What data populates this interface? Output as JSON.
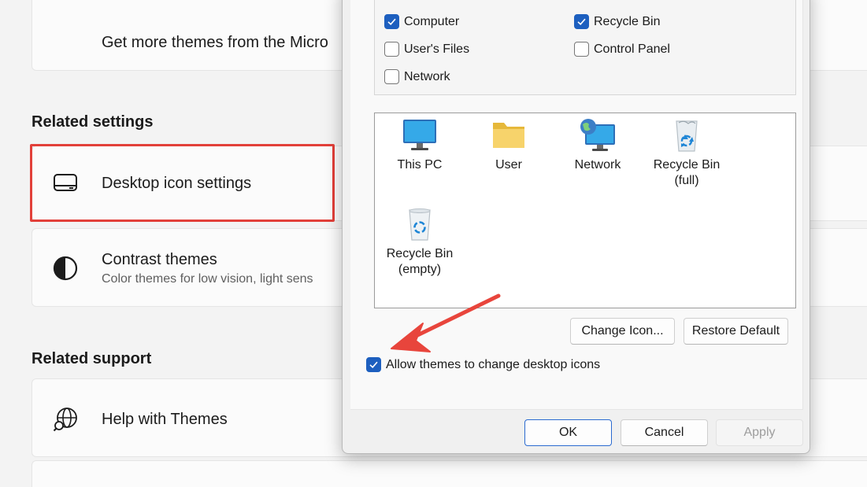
{
  "settings": {
    "get_more_themes": "Get more themes from the Micro",
    "related_settings_heading": "Related settings",
    "desktop_icon_settings": "Desktop icon settings",
    "contrast_themes": "Contrast themes",
    "contrast_themes_sub": "Color themes for low vision, light sens",
    "related_support_heading": "Related support",
    "help_with_themes": "Help with Themes"
  },
  "dialog": {
    "checkboxes": [
      {
        "label": "Computer",
        "checked": true
      },
      {
        "label": "Recycle Bin",
        "checked": true
      },
      {
        "label": "User's Files",
        "checked": false
      },
      {
        "label": "Control Panel",
        "checked": false
      },
      {
        "label": "Network",
        "checked": false
      }
    ],
    "icons": [
      {
        "line1": "This PC",
        "line2": ""
      },
      {
        "line1": "User",
        "line2": ""
      },
      {
        "line1": "Network",
        "line2": ""
      },
      {
        "line1": "Recycle Bin",
        "line2": "(full)"
      },
      {
        "line1": "Recycle Bin",
        "line2": "(empty)"
      }
    ],
    "change_icon_label": "Change Icon...",
    "restore_default_label": "Restore Default",
    "allow_themes_label": "Allow themes to change desktop icons",
    "allow_themes_checked": true,
    "ok_label": "OK",
    "cancel_label": "Cancel",
    "apply_label": "Apply"
  },
  "colors": {
    "accent": "#1d5fbf",
    "highlight_border": "#e2403a",
    "arrow": "#e8453c"
  }
}
